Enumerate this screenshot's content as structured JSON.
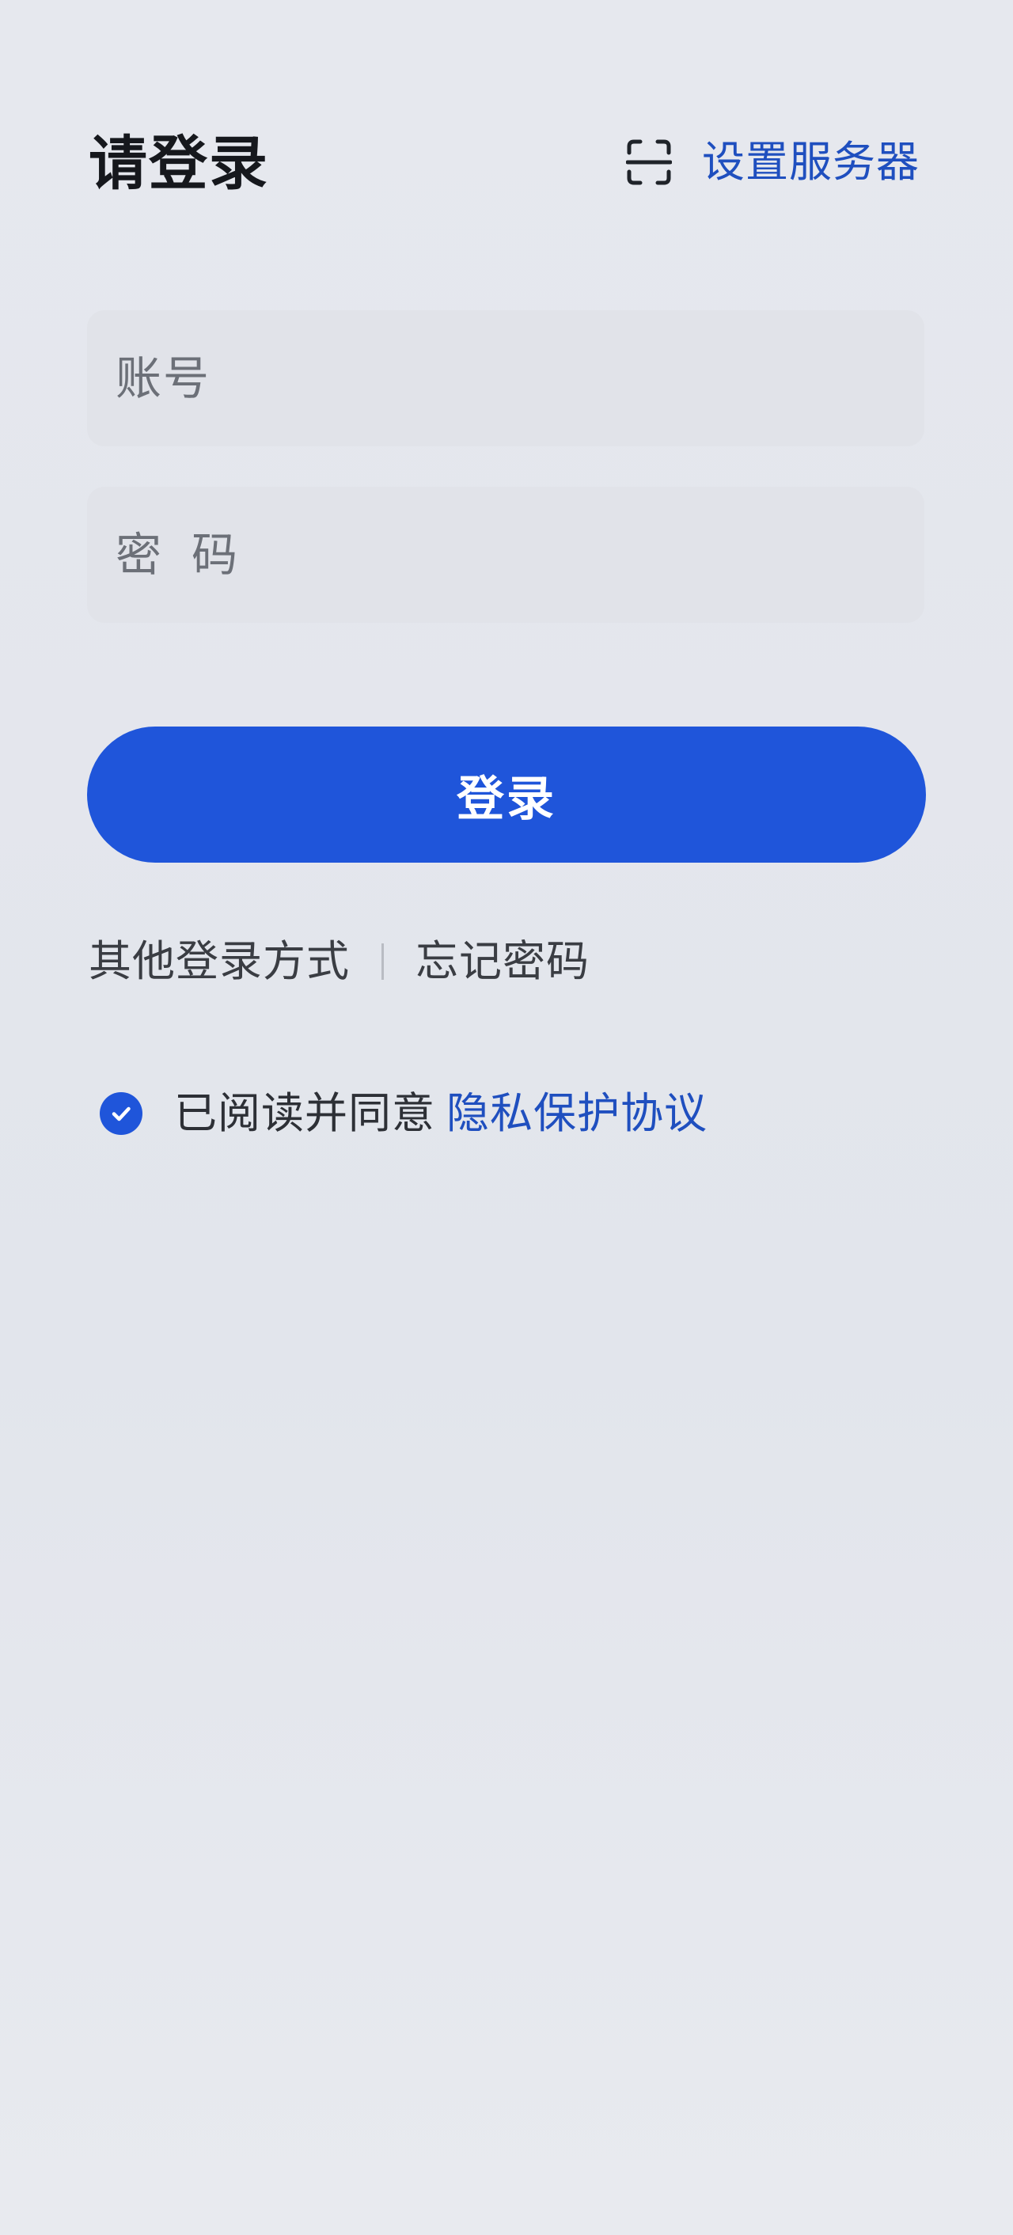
{
  "header": {
    "title": "请登录",
    "server_settings_label": "设置服务器",
    "scan_icon": "scan-frame-icon"
  },
  "form": {
    "account_placeholder": "账号",
    "password_placeholder": "密码",
    "account_value": "",
    "password_value": ""
  },
  "login_button": {
    "label": "登录"
  },
  "links": {
    "other_login_label": "其他登录方式",
    "forgot_password_label": "忘记密码"
  },
  "agreement": {
    "checked": true,
    "prefix_text": "已阅读并同意",
    "privacy_link_label": "隐私保护协议",
    "check_icon": "check-circle-icon"
  },
  "colors": {
    "accent": "#1f55da",
    "link": "#1f4fbf",
    "background": "#e4e6ec"
  }
}
